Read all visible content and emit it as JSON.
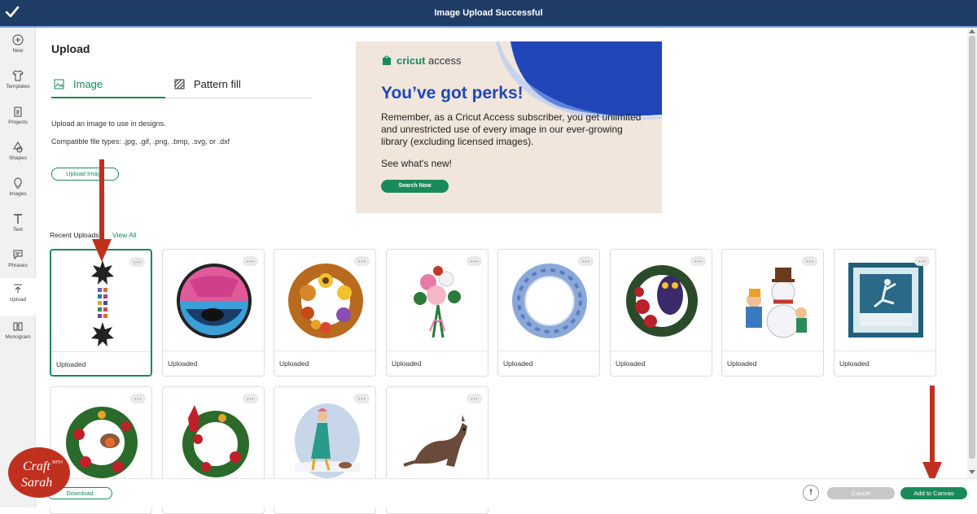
{
  "topbar": {
    "title": "Image Upload Successful"
  },
  "sidebar": {
    "items": [
      {
        "label": "New",
        "icon": "plus-circle-icon"
      },
      {
        "label": "Templates",
        "icon": "shirt-icon"
      },
      {
        "label": "Projects",
        "icon": "clipboard-icon"
      },
      {
        "label": "Shapes",
        "icon": "shapes-icon"
      },
      {
        "label": "Images",
        "icon": "lightbulb-icon"
      },
      {
        "label": "Text",
        "icon": "text-icon"
      },
      {
        "label": "Phrases",
        "icon": "speech-bubble-icon"
      },
      {
        "label": "Upload",
        "icon": "upload-icon"
      },
      {
        "label": "Monogram",
        "icon": "monogram-icon"
      }
    ],
    "active": "Upload"
  },
  "upload": {
    "title": "Upload",
    "tabs": [
      {
        "label": "Image"
      },
      {
        "label": "Pattern fill"
      }
    ],
    "description": "Upload an image to use in designs.",
    "file_types": "Compatible file types: .jpg, .gif, .png, .bmp, .svg, or .dxf",
    "upload_button": "Upload Image"
  },
  "promo": {
    "brand": "cricut",
    "brand_suffix": "access",
    "headline": "You’ve got perks!",
    "body": "Remember, as a Cricut Access subscriber, you get unlimited and unrestricted use of every image in our ever-growing library (excluding licensed images).",
    "see_new": "See what's new!",
    "button": "Search Now"
  },
  "recent": {
    "label": "Recent Uploads",
    "view_all": "View All",
    "items": [
      {
        "status": "Uploaded",
        "icon": "stars-strip-image"
      },
      {
        "status": "Uploaded",
        "icon": "bear-circle-image"
      },
      {
        "status": "Uploaded",
        "icon": "autumn-wreath-image"
      },
      {
        "status": "Uploaded",
        "icon": "flower-bouquet-image"
      },
      {
        "status": "Uploaded",
        "icon": "snowflake-wreath-image"
      },
      {
        "status": "Uploaded",
        "icon": "owl-rose-wreath-image"
      },
      {
        "status": "Uploaded",
        "icon": "snowman-kids-image"
      },
      {
        "status": "Uploaded",
        "icon": "ice-skater-frame-image"
      },
      {
        "status": "",
        "icon": "robin-wreath-image"
      },
      {
        "status": "",
        "icon": "cardinal-wreath-image"
      },
      {
        "status": "",
        "icon": "woman-dog-snow-image"
      },
      {
        "status": "",
        "icon": "wallaby-image"
      }
    ]
  },
  "footer": {
    "download": "Download",
    "cancel": "Cancel",
    "add_to_canvas": "Add to Canvas"
  },
  "logo": {
    "text": "Craft with Sarah"
  },
  "colors": {
    "accent": "#1a8a5a",
    "topbar": "#1f3d66",
    "promo_blue": "#2046b8",
    "arrow": "#c0301f"
  }
}
